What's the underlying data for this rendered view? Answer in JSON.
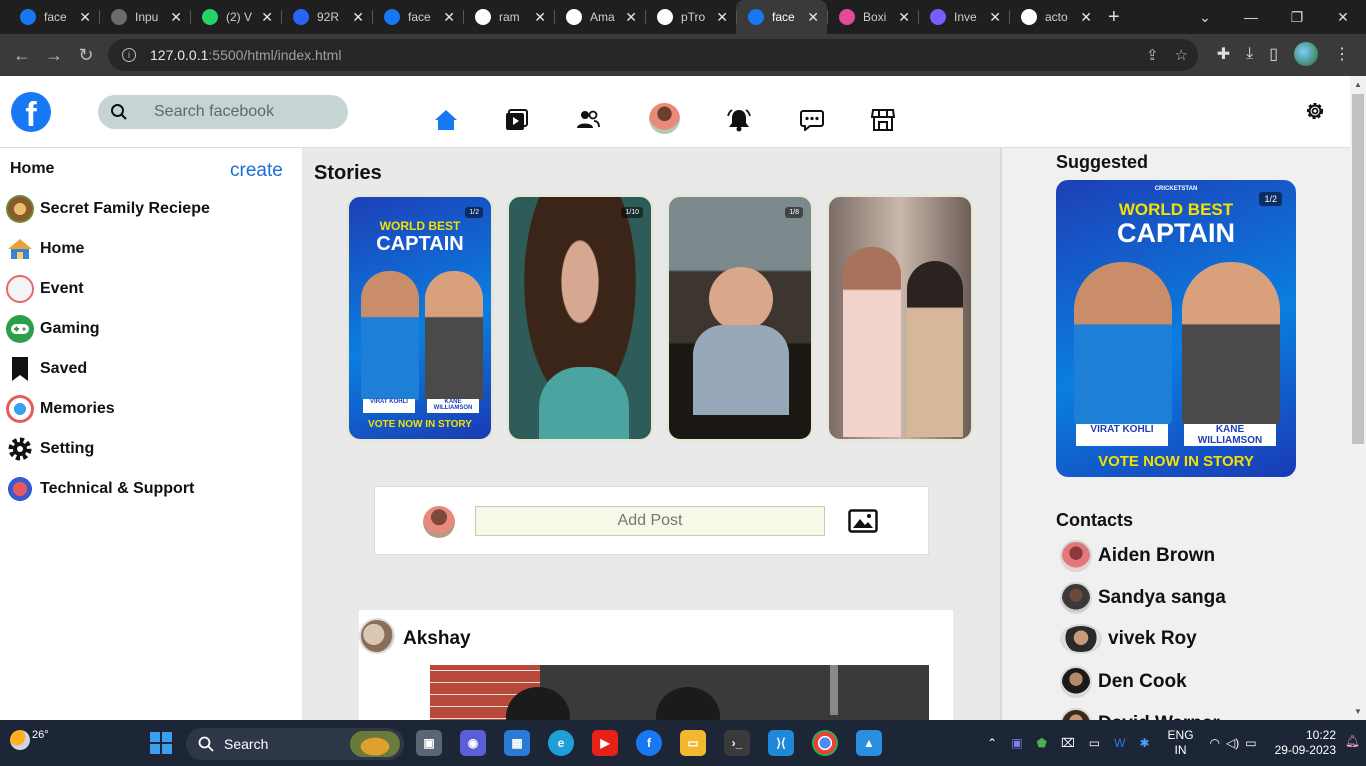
{
  "browser": {
    "tabs": [
      {
        "title": "face",
        "icon": "facebook-icon",
        "color": "#1877f2"
      },
      {
        "title": "Inpu",
        "icon": "chatgpt-icon",
        "color": "#6b6b6b"
      },
      {
        "title": "(2) V",
        "icon": "whatsapp-icon",
        "color": "#25d366"
      },
      {
        "title": "92R",
        "icon": "zoho-icon",
        "color": "#2a64f6"
      },
      {
        "title": "face",
        "icon": "facebook-icon",
        "color": "#1877f2"
      },
      {
        "title": "ram",
        "icon": "google-icon",
        "color": "#ffffff"
      },
      {
        "title": "Ama",
        "icon": "amazon-icon",
        "color": "#ffffff"
      },
      {
        "title": "pTro",
        "icon": "amazon-icon",
        "color": "#ffffff"
      },
      {
        "title": "face",
        "icon": "facebook-icon",
        "color": "#1877f2",
        "active": true
      },
      {
        "title": "Boxi",
        "icon": "cube-icon",
        "color": "#e34b9a"
      },
      {
        "title": "Inve",
        "icon": "invest-icon",
        "color": "#7b5cff"
      },
      {
        "title": "acto",
        "icon": "google-icon",
        "color": "#ffffff"
      }
    ],
    "url_host": "127.0.0.1",
    "url_rest": ":5500/html/index.html"
  },
  "header": {
    "search_placeholder": "Search facebook",
    "logo_letter": "f"
  },
  "leftbar": {
    "title": "Home",
    "create_label": "create",
    "items": [
      {
        "label": "Secret Family Reciepe",
        "icon": "recipe-icon"
      },
      {
        "label": "Home",
        "icon": "house-icon"
      },
      {
        "label": "Event",
        "icon": "calendar-icon"
      },
      {
        "label": "Gaming",
        "icon": "gamepad-icon"
      },
      {
        "label": "Saved",
        "icon": "bookmark-icon"
      },
      {
        "label": "Memories",
        "icon": "memories-icon"
      },
      {
        "label": "Setting",
        "icon": "gear-icon"
      },
      {
        "label": "Technical & Support",
        "icon": "support-icon"
      }
    ]
  },
  "main": {
    "stories_title": "Stories",
    "stories": [
      {
        "badge": "1/2",
        "heading1": "WORLD BEST",
        "heading2": "CAPTAIN",
        "footer": "VOTE NOW IN STORY",
        "left_name": "VIRAT KOHLI",
        "right_name": "KANE WILLIAMSON"
      },
      {
        "badge": "1/10"
      },
      {
        "badge": "1/8"
      },
      {
        "badge": ""
      }
    ],
    "add_post_placeholder": "Add Post",
    "post": {
      "author": "Akshay"
    }
  },
  "rightbar": {
    "suggested_title": "Suggested",
    "suggested_card": {
      "badge": "1/2",
      "heading1": "WORLD BEST",
      "heading2": "CAPTAIN",
      "footer": "VOTE NOW IN STORY",
      "left_name": "VIRAT KOHLI",
      "right_name": "KANE WILLIAMSON",
      "brand": "CRICKETSTAN"
    },
    "contacts_title": "Contacts",
    "contacts": [
      "Aiden Brown",
      "Sandya sanga",
      "vivek Roy",
      "Den Cook",
      "David Warner"
    ]
  },
  "taskbar": {
    "temperature": "26°",
    "search_label": "Search",
    "lang_line1": "ENG",
    "lang_line2": "IN",
    "time": "10:22",
    "date": "29-09-2023"
  }
}
